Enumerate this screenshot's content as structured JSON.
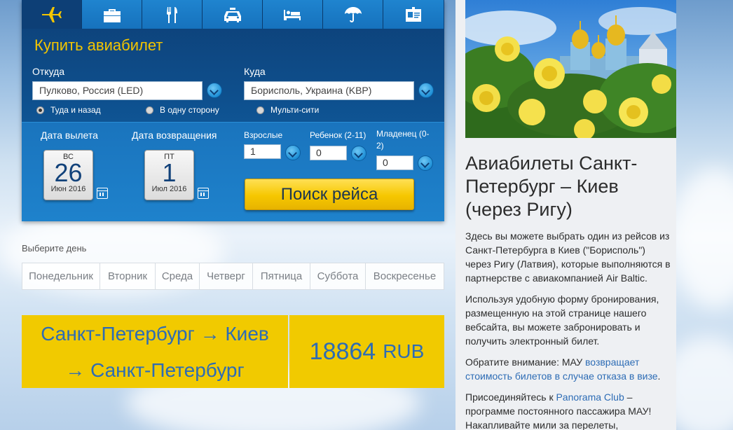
{
  "tabs": [
    {
      "icon": "airplane-icon",
      "active": true
    },
    {
      "icon": "suitcase-icon",
      "active": false
    },
    {
      "icon": "restaurant-icon",
      "active": false
    },
    {
      "icon": "taxi-icon",
      "active": false
    },
    {
      "icon": "hotel-bed-icon",
      "active": false
    },
    {
      "icon": "umbrella-icon",
      "active": false
    },
    {
      "icon": "id-card-icon",
      "active": false
    }
  ],
  "booking": {
    "title": "Купить авиабилет",
    "from_label": "Откуда",
    "from_value": "Пулково, Россия (LED)",
    "to_label": "Куда",
    "to_value": "Борисполь, Украина (KBP)",
    "trip_types": [
      {
        "label": "Туда и назад",
        "selected": true
      },
      {
        "label": "В одну сторону",
        "selected": false
      },
      {
        "label": "Мульти-сити",
        "selected": false
      }
    ],
    "departure_label": "Дата вылета",
    "departure": {
      "dow": "ВС",
      "day": "26",
      "month": "Июн 2016"
    },
    "return_label": "Дата возвращения",
    "return": {
      "dow": "ПТ",
      "day": "1",
      "month": "Июл 2016"
    },
    "adults_label": "Взрослые",
    "adults_value": "1",
    "child_label": "Ребенок (2-11)",
    "child_value": "0",
    "infant_label_1": "Младенец (0-",
    "infant_label_2": "2)",
    "infant_value": "0",
    "search_button": "Поиск рейса"
  },
  "week": {
    "label": "Выберите день",
    "days": [
      "Понедельник",
      "Вторник",
      "Среда",
      "Четверг",
      "Пятница",
      "Суббота",
      "Воскресенье"
    ]
  },
  "offer": {
    "route_line1": "Санкт-Петербург → Киев",
    "route_line2": "→ Санкт-Петербург",
    "price": "18864",
    "currency": "RUB"
  },
  "article": {
    "title": "Авиабилеты Санкт-Петербург – Киев (через Ригу)",
    "p1": "Здесь вы можете выбрать один из рейсов из Санкт-Петербурга в Киев (\"Борисполь\") через Ригу (Латвия), которые выполняются в партнерстве с авиакомпанией Air Baltic.",
    "p2": "Используя удобную форму бронирования, размещенную на этой странице нашего вебсайта, вы можете забронировать и получить электронный билет.",
    "p3_prefix": "Обратите внимание: МАУ ",
    "p3_link": "возвращает стоимость билетов в случае отказа в визе",
    "p3_suffix": ".",
    "p4_prefix": "Присоединяйтесь к ",
    "p4_link": "Panorama Club",
    "p4_suffix": " – программе постоянного пассажира МАУ! Накапливайте мили за перелеты,"
  },
  "colors": {
    "accent_yellow": "#f1ca00",
    "brand_blue": "#0e508e",
    "link_blue": "#2d6cb5"
  }
}
